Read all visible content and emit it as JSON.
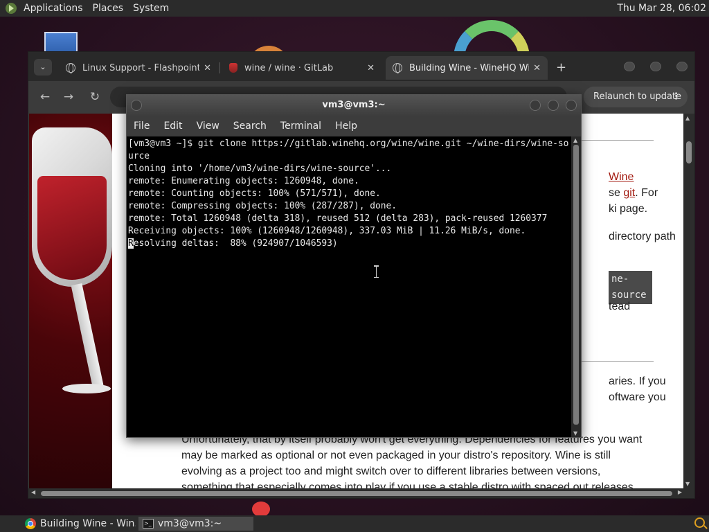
{
  "top_panel": {
    "menus": [
      "Applications",
      "Places",
      "System"
    ],
    "clock": "Thu Mar 28, 06:02"
  },
  "browser": {
    "tabs": [
      {
        "label": "Linux Support - Flashpoint Da",
        "favicon": "globe-icon"
      },
      {
        "label": "wine / wine · GitLab",
        "favicon": "gitlab-icon"
      },
      {
        "label": "Building Wine - WineHQ Wiki",
        "favicon": "globe-icon",
        "active": true
      }
    ],
    "relaunch_label": "Relaunch to update",
    "page": {
      "link_wine": "Wine",
      "frag_git_pre": "se ",
      "link_git": "git",
      "frag_git_post": ". For",
      "frag_wiki": "ki page.",
      "frag_dir": "directory path",
      "code_source": "ne-source",
      "frag_instead": "tead",
      "frag_libraries": "aries. If you",
      "frag_software": "oftware you",
      "paragraph": "Unfortunately, that by itself probably won't get everything. Dependencies for features you want may be marked as optional or not even packaged in your distro's repository. Wine is still evolving as a project too and might switch over to different libraries between versions, something that especially comes into play if you use a stable distro with spaced out releases."
    }
  },
  "terminal": {
    "title": "vm3@vm3:~",
    "menus": [
      "File",
      "Edit",
      "View",
      "Search",
      "Terminal",
      "Help"
    ],
    "lines": [
      "[vm3@vm3 ~]$ git clone https://gitlab.winehq.org/wine/wine.git ~/wine-dirs/wine-source",
      "Cloning into '/home/vm3/wine-dirs/wine-source'...",
      "remote: Enumerating objects: 1260948, done.",
      "remote: Counting objects: 100% (571/571), done.",
      "remote: Compressing objects: 100% (287/287), done.",
      "remote: Total 1260948 (delta 318), reused 512 (delta 283), pack-reused 1260377",
      "Receiving objects: 100% (1260948/1260948), 337.03 MiB | 11.26 MiB/s, done."
    ],
    "cursor_char": "R",
    "last_line_rest": "esolving deltas:  88% (924907/1046593)"
  },
  "taskbar": {
    "tasks": [
      {
        "label": "Building Wine - Win...",
        "icon": "chrome-icon"
      },
      {
        "label": "vm3@vm3:~",
        "icon": "terminal-icon",
        "active": true
      }
    ]
  }
}
